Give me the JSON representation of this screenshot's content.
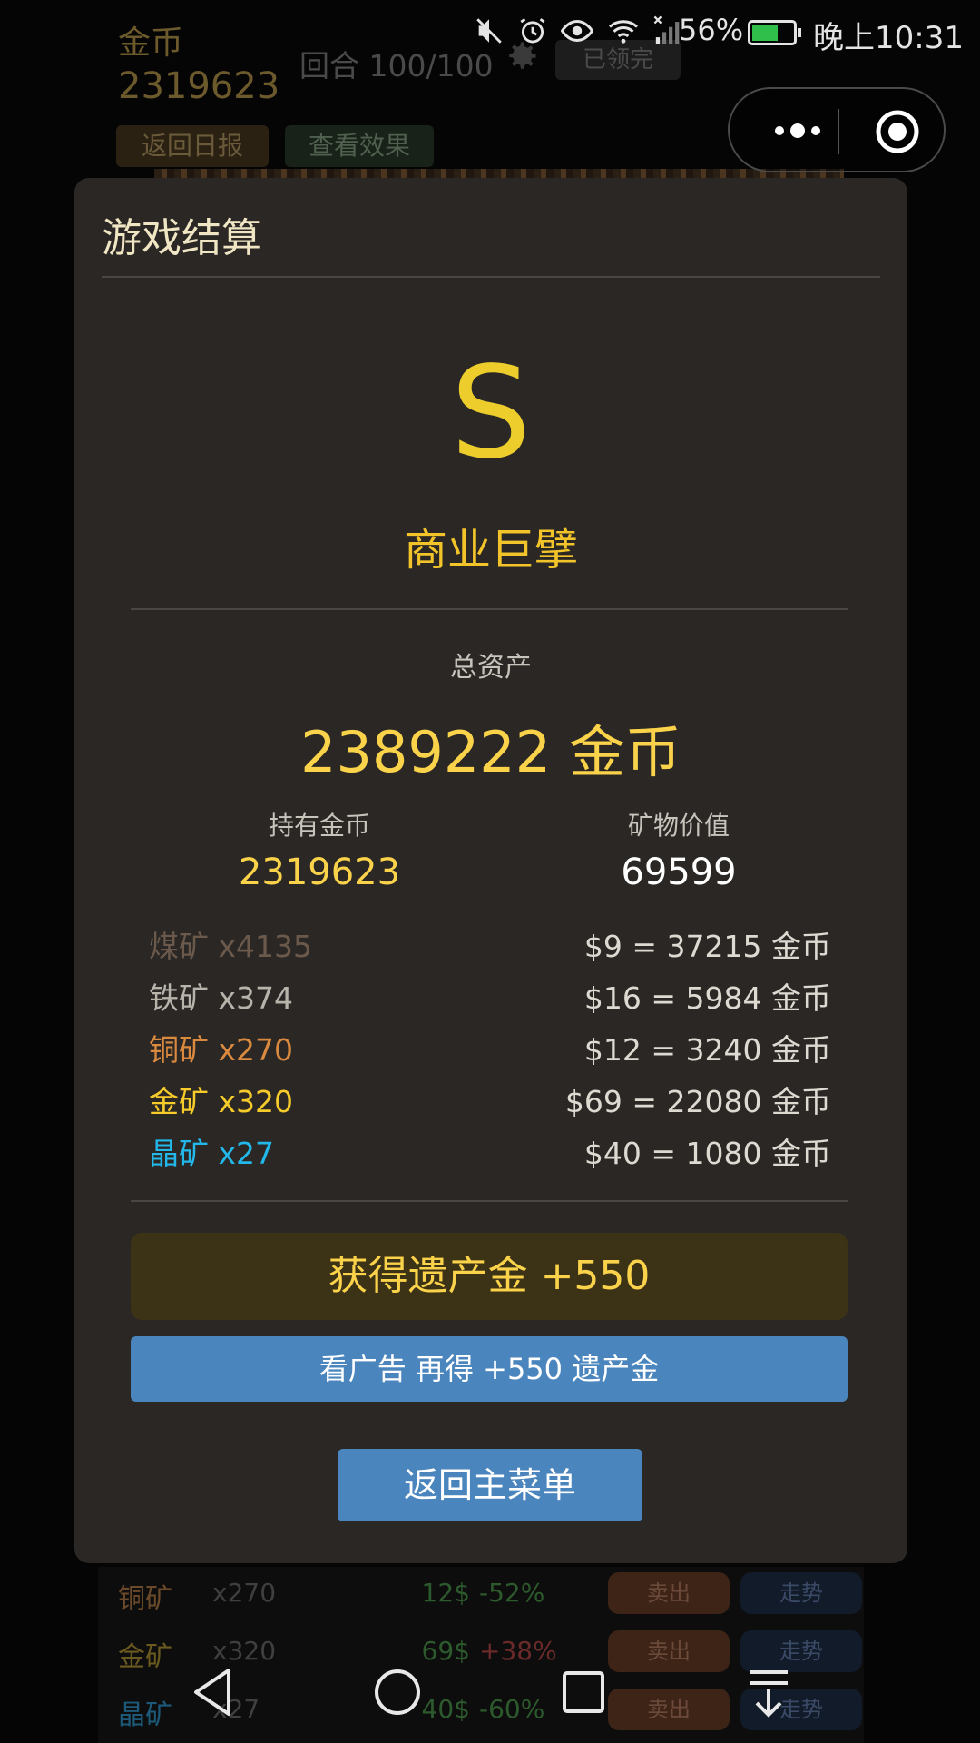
{
  "status_bar": {
    "battery_percent": "56%",
    "battery_level": 0.56,
    "time": "晚上10:31",
    "icons": [
      "mute-icon",
      "alarm-icon",
      "eye-icon",
      "wifi-icon",
      "signal-icon"
    ]
  },
  "background": {
    "gold_label": "金币",
    "gold_value": "2319623",
    "round_text": "回合 100/100",
    "claimed_label": "已领完",
    "report_button": "返回日报",
    "effect_button": "查看效果",
    "table_rows": [
      {
        "name": "铜矿",
        "qty": "x270",
        "price": "12$",
        "change": "-52%",
        "sell": "卖出",
        "trend": "走势"
      },
      {
        "name": "金矿",
        "qty": "x320",
        "price": "69$",
        "change": "+38%",
        "sell": "卖出",
        "trend": "走势"
      },
      {
        "name": "晶矿",
        "qty": "x27",
        "price": "40$",
        "change": "-60%",
        "sell": "卖出",
        "trend": "走势"
      }
    ]
  },
  "modal": {
    "title": "游戏结算",
    "grade": "S",
    "rank_title": "商业巨擘",
    "total_label": "总资产",
    "total_value": "2389222 金币",
    "gold_label": "持有金币",
    "gold_value": "2319623",
    "mineral_label": "矿物价值",
    "mineral_value": "69599",
    "ores": [
      {
        "name": "煤矿 x4135",
        "calc": "$9 = 37215 金币",
        "color": "#6b5a4c"
      },
      {
        "name": "铁矿 x374",
        "calc": "$16 = 5984 金币",
        "color": "#b8b4ac"
      },
      {
        "name": "铜矿 x270",
        "calc": "$12 = 3240 金币",
        "color": "#d98a3e"
      },
      {
        "name": "金矿 x320",
        "calc": "$69 = 22080 金币",
        "color": "#f6cb2a"
      },
      {
        "name": "晶矿 x27",
        "calc": "$40 = 1080 金币",
        "color": "#22b8ea"
      }
    ],
    "legacy_reward": "获得遗产金  +550",
    "ad_button": "看广告 再得 +550 遗产金",
    "menu_button": "返回主菜单"
  },
  "colors": {
    "accent_gold": "#fbd34a",
    "button_blue": "#4a86bd",
    "modal_bg": "#2a2725"
  }
}
